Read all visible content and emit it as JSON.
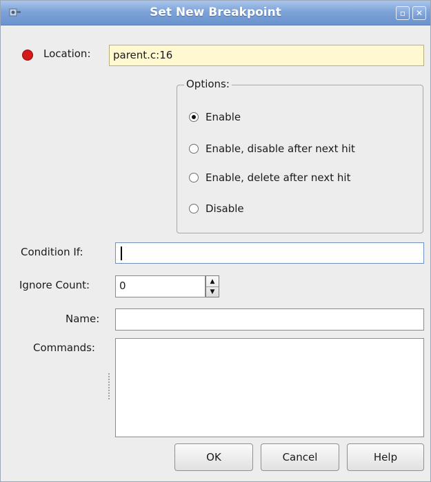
{
  "window": {
    "title": "Set New Breakpoint",
    "icon": "breakpoint-app-icon",
    "controls": [
      "maximize-icon",
      "close-icon"
    ]
  },
  "location": {
    "label": "Location:",
    "value": "parent.c:16",
    "marker_color": "#d41a1a",
    "field_color": "#fff8d0"
  },
  "options": {
    "title": "Options:",
    "items": [
      {
        "label": "Enable",
        "checked": true
      },
      {
        "label": "Enable, disable after next hit",
        "checked": false
      },
      {
        "label": "Enable, delete after next hit",
        "checked": false
      },
      {
        "label": "Disable",
        "checked": false
      }
    ]
  },
  "condition": {
    "label": "Condition If:",
    "value": ""
  },
  "ignore_count": {
    "label": "Ignore Count:",
    "value": "0"
  },
  "name": {
    "label": "Name:",
    "value": ""
  },
  "commands": {
    "label": "Commands:",
    "value": ""
  },
  "buttons": {
    "ok": "OK",
    "cancel": "Cancel",
    "help": "Help"
  }
}
